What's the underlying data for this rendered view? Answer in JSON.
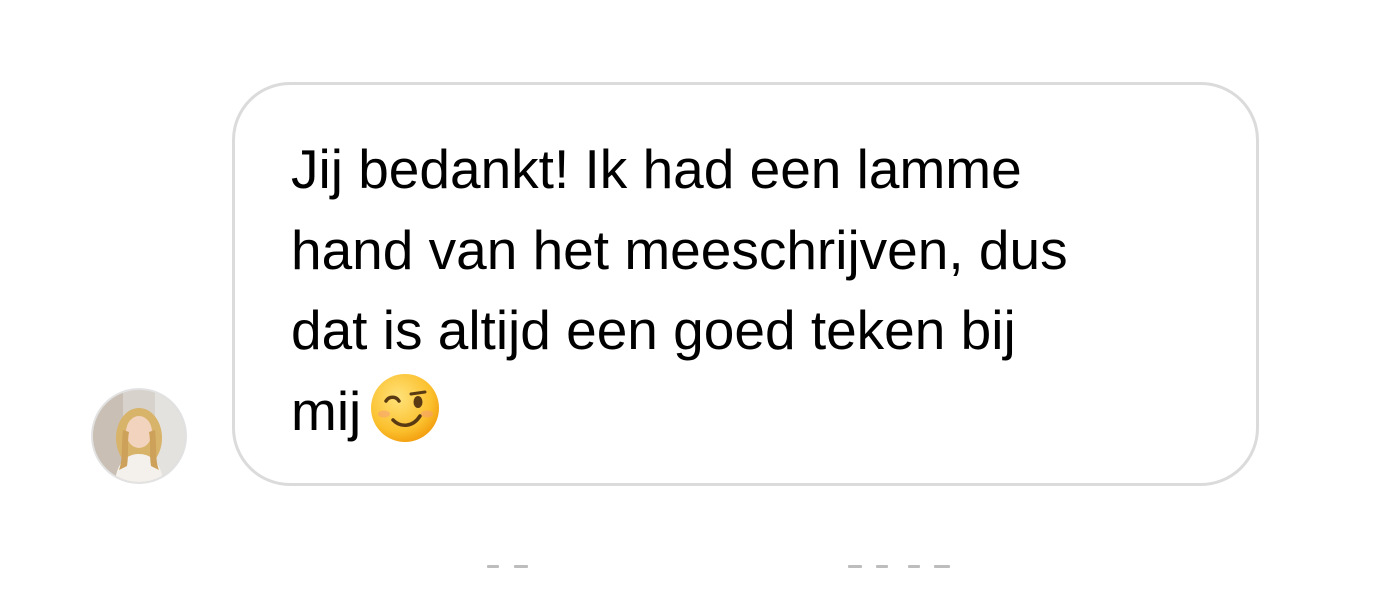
{
  "message": {
    "line_1": "Jij bedankt! Ik had een lamme",
    "line_2": "hand van het meeschrijven, dus",
    "line_3": "dat is altijd een goed teken bij",
    "line_4": "mij",
    "emoji": "winking-face-emoji"
  },
  "sender": {
    "avatar": "profile-photo"
  },
  "colors": {
    "bubble_border": "#dbdbdb",
    "text": "#000000",
    "timestamp": "#b8b8b8"
  }
}
